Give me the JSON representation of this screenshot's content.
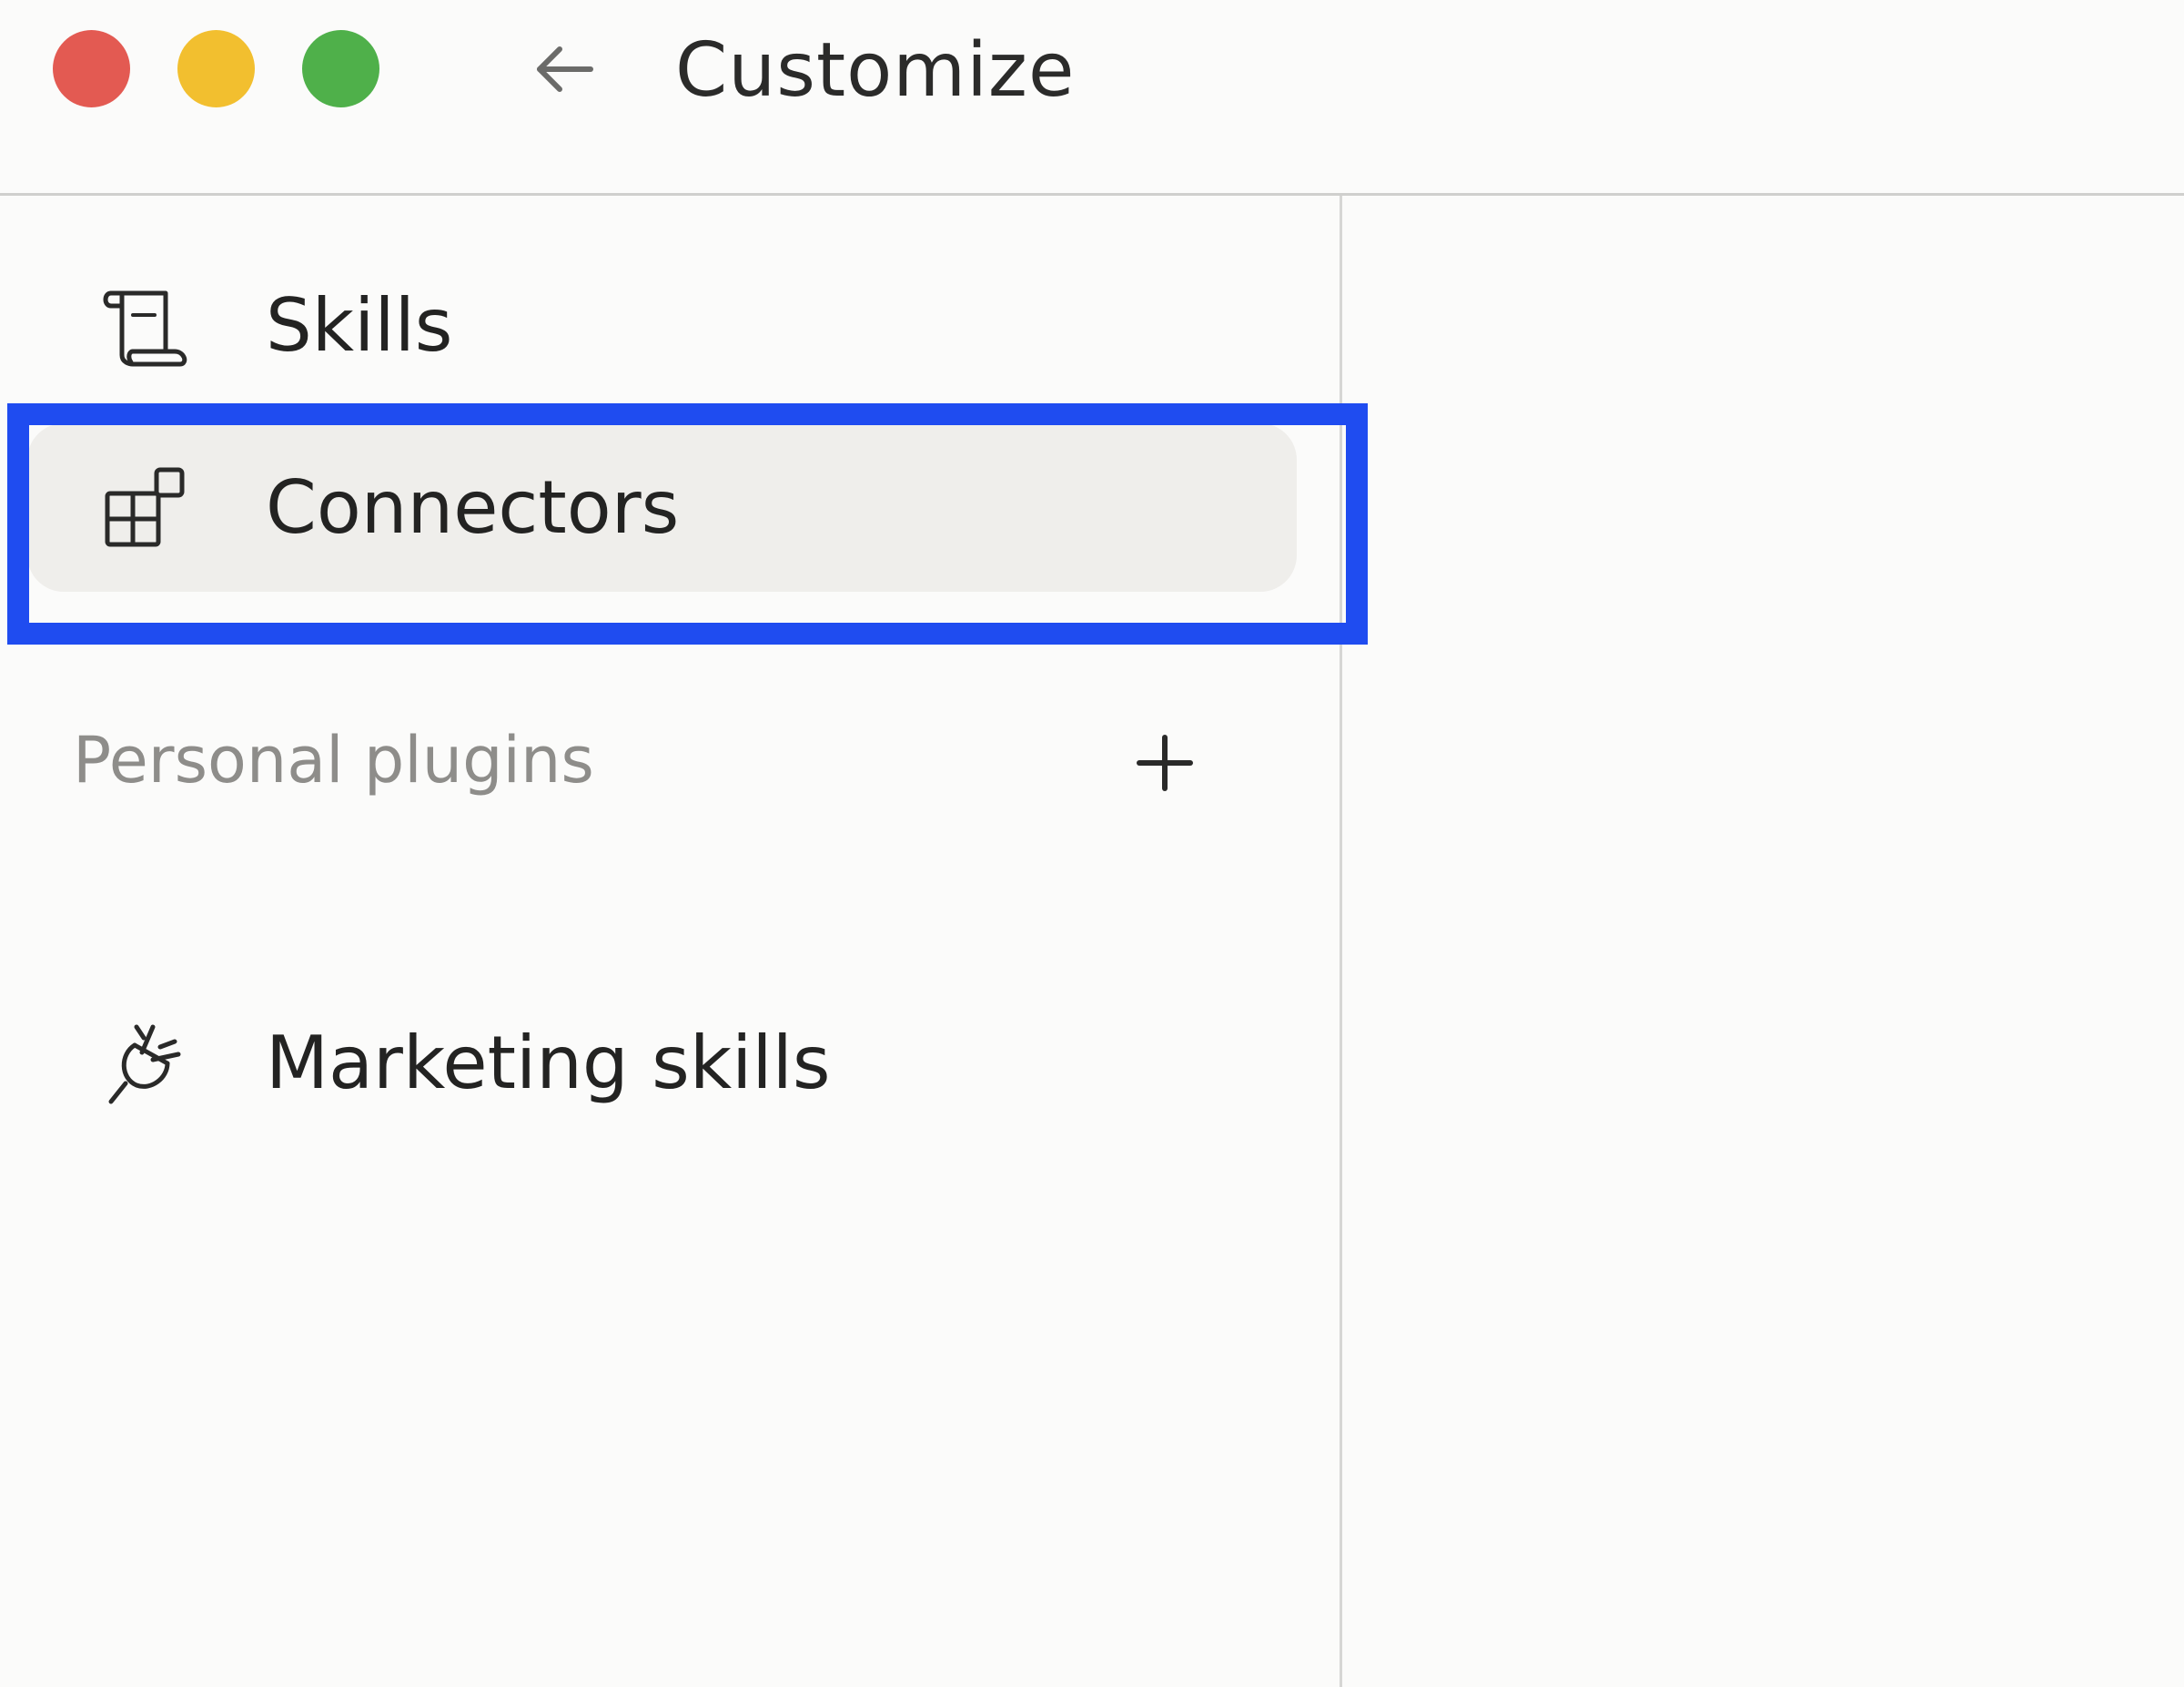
{
  "window": {
    "title": "Customize"
  },
  "traffic_lights": {
    "close_color": "#e35a52",
    "minimize_color": "#f2bf2f",
    "maximize_color": "#4fb04a"
  },
  "sidebar": {
    "items": [
      {
        "label": "Skills",
        "icon": "scroll-icon"
      },
      {
        "label": "Connectors",
        "icon": "connectors-grid-icon",
        "selected": true
      }
    ],
    "section_header": "Personal plugins",
    "plugins": [
      {
        "label": "Marketing skills",
        "icon": "plug-icon"
      }
    ]
  },
  "highlight": {
    "color": "#1f4cf0",
    "target": "Connectors"
  }
}
